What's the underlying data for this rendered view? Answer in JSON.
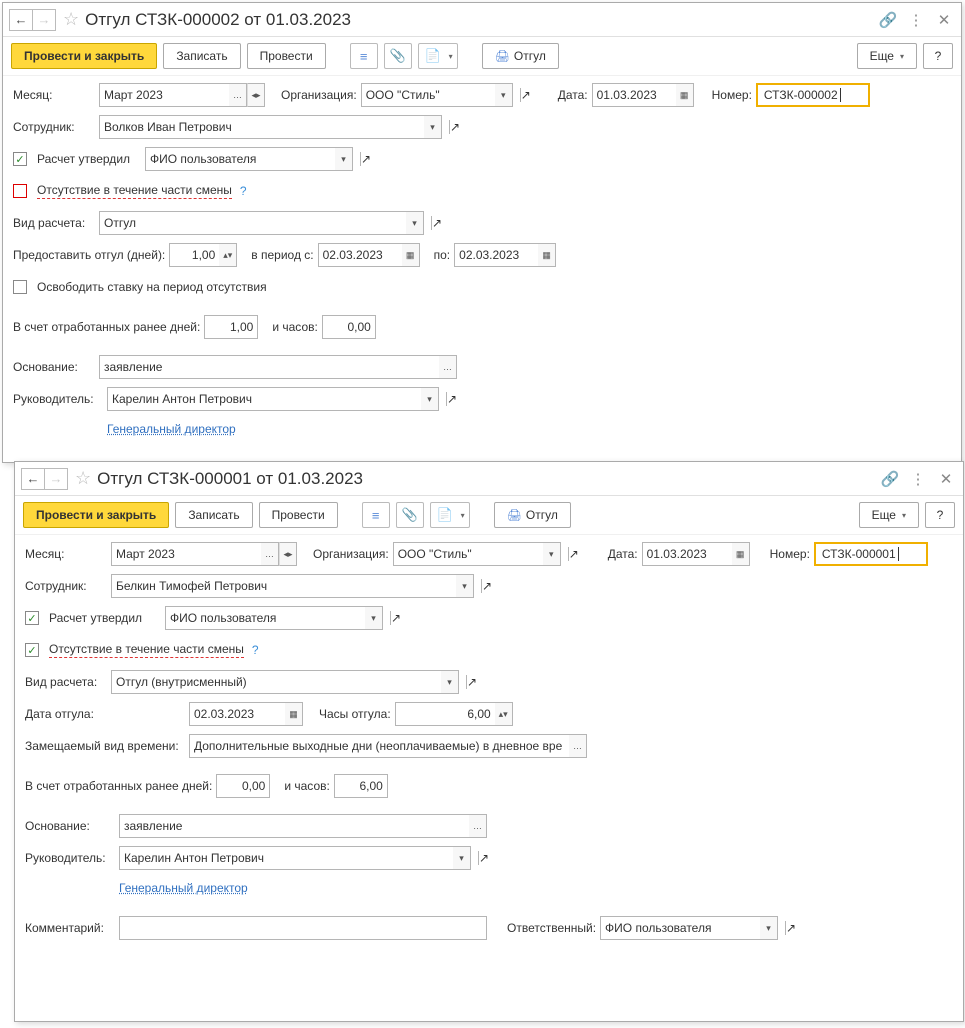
{
  "win1": {
    "title": "Отгул СТЗК-000002 от 01.03.2023",
    "toolbar": {
      "post_close": "Провести и закрыть",
      "write": "Записать",
      "post": "Провести",
      "print": "Отгул",
      "more": "Еще",
      "help": "?"
    },
    "header": {
      "month_lbl": "Месяц:",
      "month_val": "Март 2023",
      "org_lbl": "Организация:",
      "org_val": "ООО \"Стиль\"",
      "date_lbl": "Дата:",
      "date_val": "01.03.2023",
      "number_lbl": "Номер:",
      "number_val": "СТЗК-000002"
    },
    "emp": {
      "lbl": "Сотрудник:",
      "val": "Волков Иван Петрович"
    },
    "approved": {
      "lbl": "Расчет утвердил",
      "val": "ФИО пользователя"
    },
    "partial": {
      "lbl": "Отсутствие в течение части смены"
    },
    "calc_type": {
      "lbl": "Вид расчета:",
      "val": "Отгул"
    },
    "days": {
      "lbl": "Предоставить отгул (дней):",
      "val": "1,00",
      "period_lbl": "в период с:",
      "from": "02.03.2023",
      "to_lbl": "по:",
      "to": "02.03.2023"
    },
    "free_rate": {
      "lbl": "Освободить ставку на период отсутствия"
    },
    "credit": {
      "lbl": "В счет отработанных ранее дней:",
      "days": "1,00",
      "hours_lbl": "и часов:",
      "hours": "0,00"
    },
    "reason": {
      "lbl": "Основание:",
      "val": "заявление"
    },
    "manager": {
      "lbl": "Руководитель:",
      "val": "Карелин Антон Петрович",
      "pos": "Генеральный директор"
    }
  },
  "win2": {
    "title": "Отгул СТЗК-000001 от 01.03.2023",
    "toolbar": {
      "post_close": "Провести и закрыть",
      "write": "Записать",
      "post": "Провести",
      "print": "Отгул",
      "more": "Еще",
      "help": "?"
    },
    "header": {
      "month_lbl": "Месяц:",
      "month_val": "Март 2023",
      "org_lbl": "Организация:",
      "org_val": "ООО \"Стиль\"",
      "date_lbl": "Дата:",
      "date_val": "01.03.2023",
      "number_lbl": "Номер:",
      "number_val": "СТЗК-000001"
    },
    "emp": {
      "lbl": "Сотрудник:",
      "val": "Белкин Тимофей Петрович"
    },
    "approved": {
      "lbl": "Расчет утвердил",
      "val": "ФИО пользователя"
    },
    "partial": {
      "lbl": "Отсутствие в течение части смены"
    },
    "calc_type": {
      "lbl": "Вид расчета:",
      "val": "Отгул (внутрисменный)"
    },
    "leave_date": {
      "lbl": "Дата отгула:",
      "val": "02.03.2023",
      "hours_lbl": "Часы отгула:",
      "hours": "6,00"
    },
    "replaced": {
      "lbl": "Замещаемый вид времени:",
      "val": "Дополнительные выходные дни (неоплачиваемые) в дневное вре"
    },
    "credit": {
      "lbl": "В счет отработанных ранее дней:",
      "days": "0,00",
      "hours_lbl": "и часов:",
      "hours": "6,00"
    },
    "reason": {
      "lbl": "Основание:",
      "val": "заявление"
    },
    "manager": {
      "lbl": "Руководитель:",
      "val": "Карелин Антон Петрович",
      "pos": "Генеральный директор"
    },
    "comment": {
      "lbl": "Комментарий:",
      "val": ""
    },
    "responsible": {
      "lbl": "Ответственный:",
      "val": "ФИО пользователя"
    }
  }
}
